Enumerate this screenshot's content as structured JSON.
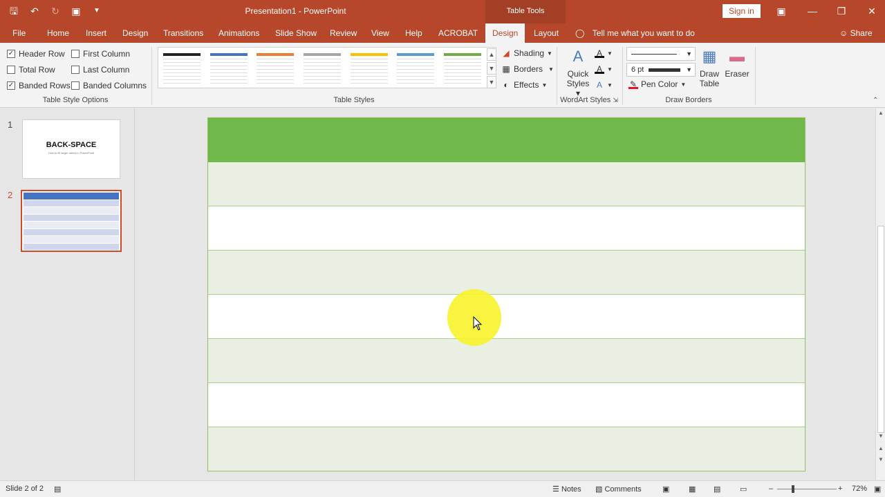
{
  "window": {
    "title": "Presentation1  -  PowerPoint",
    "context_tab_group": "Table Tools",
    "sign_in": "Sign in"
  },
  "quick_access": [
    "save-icon",
    "undo-icon",
    "redo-icon",
    "present-icon",
    "customize-icon"
  ],
  "tabs": [
    "File",
    "Home",
    "Insert",
    "Design",
    "Transitions",
    "Animations",
    "Slide Show",
    "Review",
    "View",
    "Help",
    "ACROBAT",
    "Design",
    "Layout"
  ],
  "active_tab": "Design",
  "tell_me": "Tell me what you want to do",
  "share": "Share",
  "ribbon": {
    "table_style_options": {
      "label": "Table Style Options",
      "header_row": {
        "label": "Header Row",
        "checked": true
      },
      "first_column": {
        "label": "First Column",
        "checked": false
      },
      "total_row": {
        "label": "Total Row",
        "checked": false
      },
      "last_column": {
        "label": "Last Column",
        "checked": false
      },
      "banded_rows": {
        "label": "Banded Rows",
        "checked": true
      },
      "banded_columns": {
        "label": "Banded Columns",
        "checked": false
      }
    },
    "table_styles": {
      "label": "Table Styles",
      "swatch_colors": [
        "#222222",
        "#4472c4",
        "#ed7d31",
        "#a5a5a5",
        "#ffc000",
        "#5b9bd5",
        "#70ad47"
      ],
      "shading": "Shading",
      "borders": "Borders",
      "effects": "Effects"
    },
    "wordart_styles": {
      "label": "WordArt Styles",
      "quick_styles_line1": "Quick",
      "quick_styles_line2": "Styles"
    },
    "draw_borders": {
      "label": "Draw Borders",
      "pen_weight": "6 pt",
      "pen_color": "Pen Color",
      "draw_table_line1": "Draw",
      "draw_table_line2": "Table",
      "eraser": "Eraser"
    }
  },
  "slides": {
    "thumb1_number": "1",
    "thumb1_title": "BACK-SPACE",
    "thumb1_subtitle": "How to fill larger tables in PowerPoint",
    "thumb2_number": "2"
  },
  "slide_table": {
    "header_color": "#70b84a",
    "band_color": "#e9efe3",
    "rows": [
      "header",
      "band",
      "plain",
      "band",
      "plain",
      "band",
      "plain",
      "band"
    ]
  },
  "status": {
    "slide_info": "Slide 2 of 2",
    "notes": "Notes",
    "comments": "Comments",
    "zoom": "72%"
  }
}
